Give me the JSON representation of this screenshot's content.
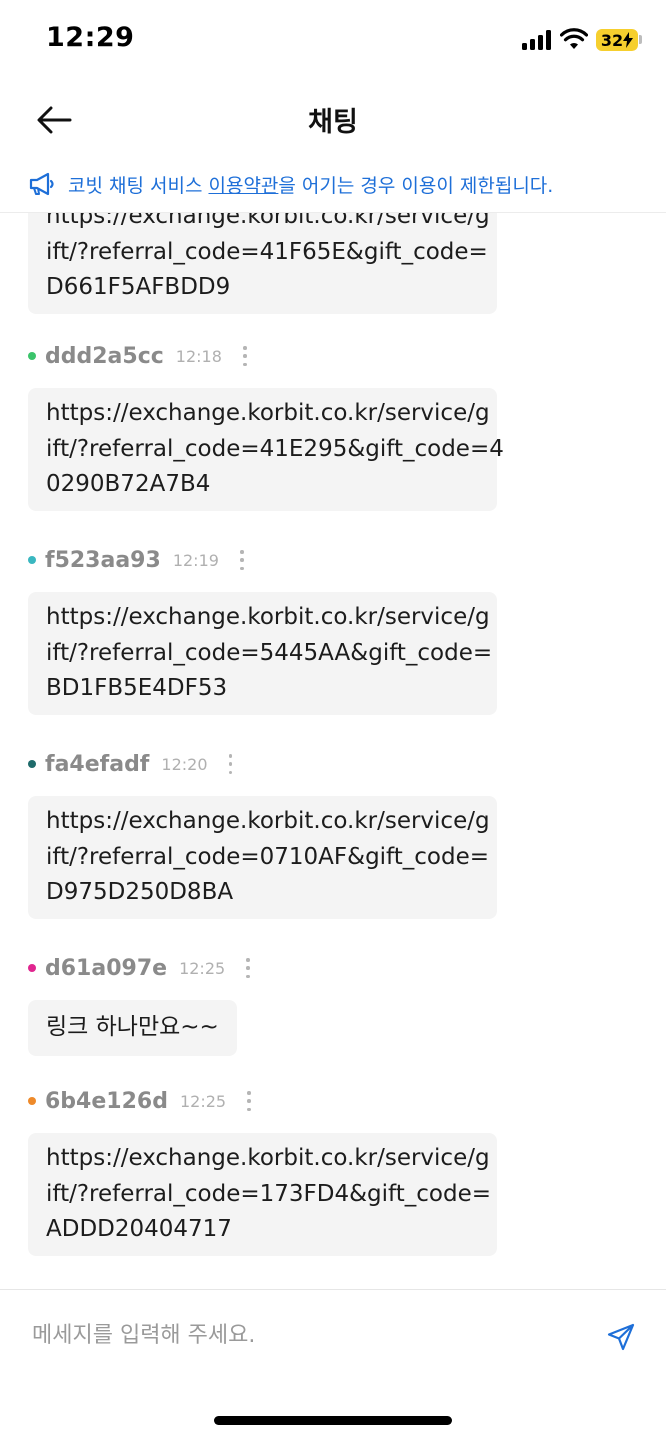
{
  "status_bar": {
    "time": "12:29",
    "battery": "32",
    "battery_color": "#f6cf2e"
  },
  "header": {
    "title": "채팅",
    "back_icon": "arrow-left-icon"
  },
  "notice": {
    "icon": "megaphone-icon",
    "prefix": "코빗 채팅 서비스 ",
    "link": "이용약관",
    "suffix": "을 어기는 경우 이용이 제한됩니다.",
    "color": "#1e6fd8"
  },
  "messages": [
    {
      "user": "",
      "time": "",
      "lines": [
        "https://exchange.korbit.co.kr/service/g",
        "ift/?referral_code=41F65E&gift_code=",
        "D661F5AFBDD9"
      ]
    },
    {
      "user": "ddd2a5cc",
      "time": "12:18",
      "dot_color": "#3bc46b",
      "lines": [
        "https://exchange.korbit.co.kr/service/g",
        "ift/?referral_code=41E295&gift_code=4",
        "0290B72A7B4"
      ]
    },
    {
      "user": "f523aa93",
      "time": "12:19",
      "dot_color": "#3ab7c0",
      "lines": [
        "https://exchange.korbit.co.kr/service/g",
        "ift/?referral_code=5445AA&gift_code=",
        "BD1FB5E4DF53"
      ]
    },
    {
      "user": "fa4efadf",
      "time": "12:20",
      "dot_color": "#1f6b6b",
      "lines": [
        "https://exchange.korbit.co.kr/service/g",
        "ift/?referral_code=0710AF&gift_code=",
        "D975D250D8BA"
      ]
    },
    {
      "user": "d61a097e",
      "time": "12:25",
      "dot_color": "#e0268f",
      "lines": [
        "링크 하나만요~~"
      ]
    },
    {
      "user": "6b4e126d",
      "time": "12:25",
      "dot_color": "#ee8a2a",
      "lines": [
        "https://exchange.korbit.co.kr/service/g",
        "ift/?referral_code=173FD4&gift_code=",
        "ADDD20404717"
      ]
    }
  ],
  "input": {
    "placeholder": "메세지를 입력해 주세요.",
    "value": "",
    "send_icon": "send-icon"
  }
}
